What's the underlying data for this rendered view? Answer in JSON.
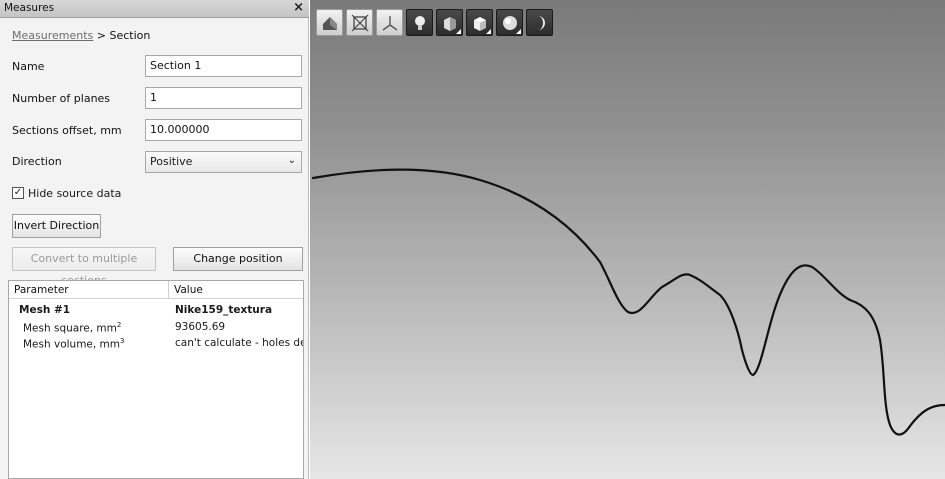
{
  "panel": {
    "title": "Measures",
    "close": "×",
    "breadcrumb": {
      "link": "Measurements",
      "separator": " > ",
      "current": "Section"
    }
  },
  "form": {
    "name_label": "Name",
    "name_value": "Section 1",
    "planes_label": "Number of planes",
    "planes_value": "1",
    "offset_label": "Sections offset, mm",
    "offset_value": "10.000000",
    "direction_label": "Direction",
    "direction_value": "Positive",
    "hide_source_label": "Hide source data",
    "hide_source_checked": "✓"
  },
  "buttons": {
    "invert": "Invert Direction",
    "convert": "Convert to multiple sections",
    "change_position": "Change position"
  },
  "table": {
    "headers": [
      "Parameter",
      "Value"
    ],
    "rows": [
      {
        "param": "Mesh #1",
        "value": "Nike159_textura"
      },
      {
        "param_base": "Mesh square, mm",
        "param_sup": "2",
        "value": "93605.69"
      },
      {
        "param_base": "Mesh volume, mm",
        "param_sup": "3",
        "value": "can't calculate - holes dete"
      }
    ]
  },
  "toolbar": {
    "icons": [
      "home-view-icon",
      "fit-view-icon",
      "axes-icon",
      "light-bulb-icon",
      "shading-icon",
      "cube-view-icon",
      "sphere-material-icon",
      "moon-shadow-icon"
    ]
  }
}
